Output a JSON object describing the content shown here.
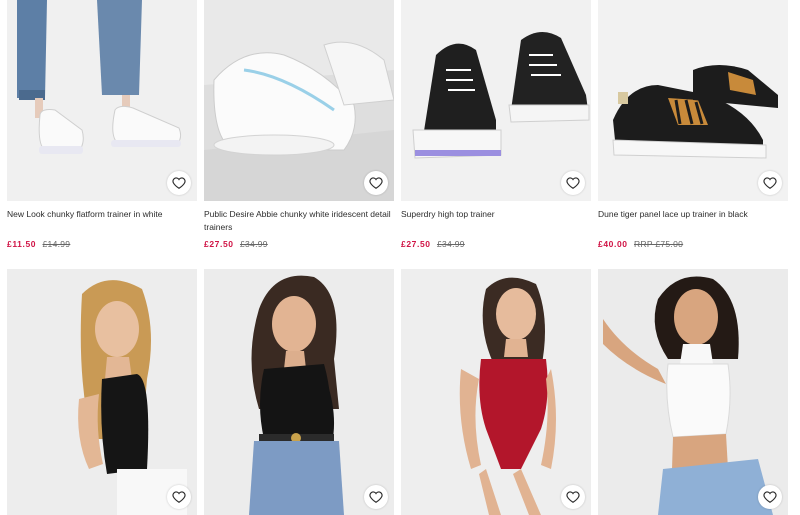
{
  "theme": {
    "sale_color": "#d01345",
    "text_color": "#2d2d2d",
    "muted_color": "#666666"
  },
  "products": [
    {
      "title": "New Look chunky flatform trainer in white",
      "price": "£11.50",
      "was_price": "£14.99",
      "image": "white-flatform-trainers-photo",
      "wishlist_icon": "heart-outline-icon"
    },
    {
      "title": "Public Desire Abbie chunky white iridescent detail trainers",
      "price": "£27.50",
      "was_price": "£34.99",
      "image": "white-chunky-trainers-photo",
      "wishlist_icon": "heart-outline-icon"
    },
    {
      "title": "Superdry high top trainer",
      "price": "£27.50",
      "was_price": "£34.99",
      "image": "black-high-top-trainers-photo",
      "wishlist_icon": "heart-outline-icon"
    },
    {
      "title": "Dune tiger panel lace up trainer in black",
      "price": "£40.00",
      "was_price": "RRP £75.00",
      "image": "black-tiger-trainers-photo",
      "wishlist_icon": "heart-outline-icon"
    },
    {
      "image": "black-ribbed-top-model-photo",
      "wishlist_icon": "heart-outline-icon"
    },
    {
      "image": "black-one-shoulder-top-model-photo",
      "wishlist_icon": "heart-outline-icon"
    },
    {
      "image": "red-lace-body-model-photo",
      "wishlist_icon": "heart-outline-icon"
    },
    {
      "image": "white-crop-top-model-photo",
      "wishlist_icon": "heart-outline-icon"
    }
  ]
}
